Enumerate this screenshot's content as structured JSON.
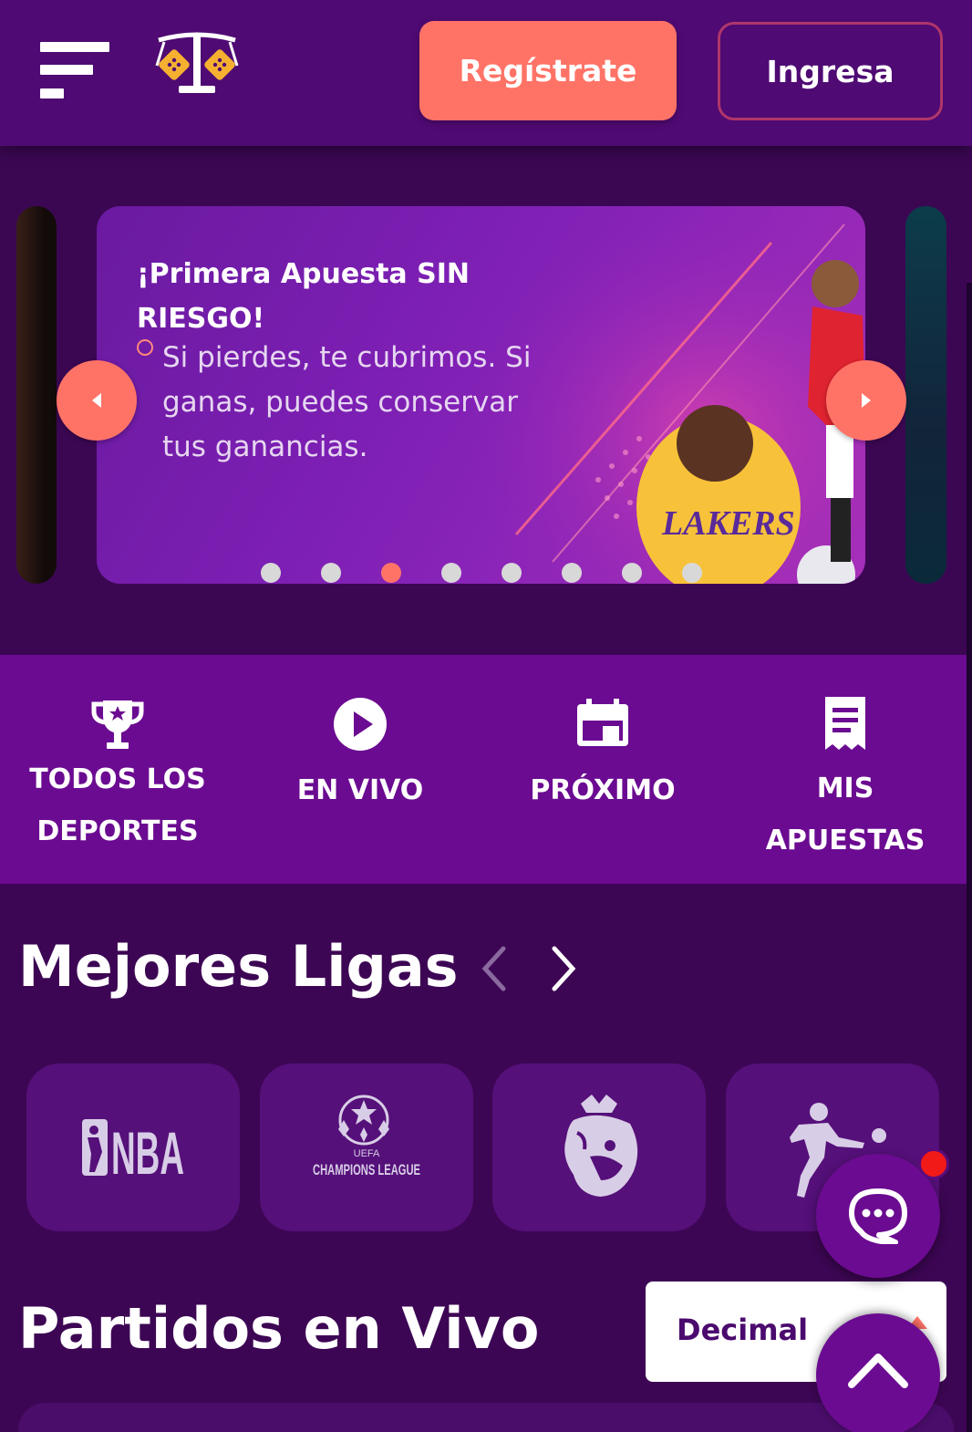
{
  "header": {
    "menu_icon": "menu-icon",
    "logo_icon": "scale-dice-logo",
    "register_label": "Regístrate",
    "login_label": "Ingresa"
  },
  "banner": {
    "title": "¡Primera Apuesta SIN RIESGO!",
    "description": "Si pierdes, te cubrimos. Si ganas, puedes conservar tus ganancias.",
    "image": "athletes-promo-image",
    "dots_total": 8,
    "active_dot": 3
  },
  "quick_nav": [
    {
      "label": "TODOS LOS DEPORTES",
      "icon": "trophy-icon"
    },
    {
      "label": "EN VIVO",
      "icon": "play-icon"
    },
    {
      "label": "PRÓXIMO",
      "icon": "calendar-icon"
    },
    {
      "label": "MIS APUESTAS",
      "icon": "receipt-icon"
    }
  ],
  "leagues": {
    "heading": "Mejores Ligas",
    "items": [
      {
        "name": "NBA",
        "icon": "nba-logo"
      },
      {
        "name": "CHAMPIONS LEAGUE",
        "sub": "UEFA",
        "icon": "champions-league-logo"
      },
      {
        "name": "Premier League",
        "icon": "premier-league-logo"
      },
      {
        "name": "Soccer",
        "icon": "soccer-player-icon"
      }
    ]
  },
  "live": {
    "heading": "Partidos en Vivo",
    "odds_format": "Decimal"
  },
  "colors": {
    "accent": "#ff7367",
    "header_bg": "#4f0a73",
    "page_bg": "#3d0654",
    "nav_bg": "#6b0b91"
  }
}
